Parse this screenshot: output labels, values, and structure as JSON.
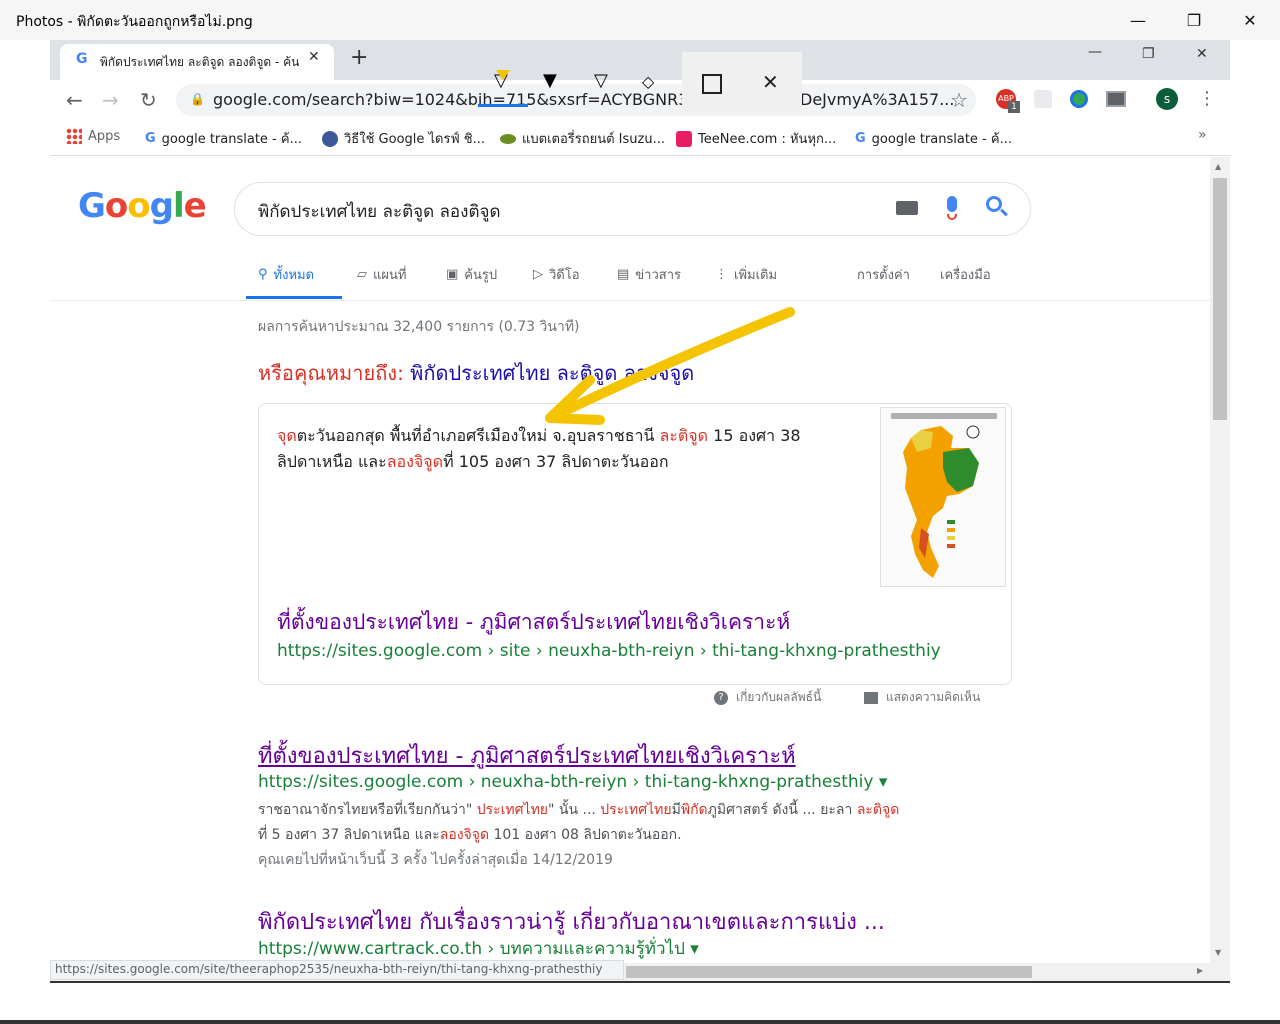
{
  "photos": {
    "title": "Photos - พิกัดตะวันออกถูกหรือไม่.png",
    "minimize": "—",
    "maximize": "❐",
    "close": "✕"
  },
  "browser": {
    "tab_title": "พิกัดประเทศไทย ละติจูด ลองติจูด - ค้นห",
    "tab_close": "✕",
    "new_tab": "+",
    "window_minimize": "—",
    "window_maximize": "❐",
    "window_close": "✕",
    "url": "google.com/search?biw=1024&bih=715&sxsrf=ACYBGNR3_Egj7p",
    "url_tail": "DeJvmyA%3A157...",
    "back": "←",
    "forward": "→",
    "reload": "↻",
    "star": "☆",
    "menu": "⋮",
    "profile_initial": "s",
    "abp_badge": "1"
  },
  "bookmarks": [
    {
      "label": "Apps",
      "icon": "apps-grid-icon"
    },
    {
      "label": "google translate - ค้...",
      "icon": "google-g-icon"
    },
    {
      "label": "วิธีใช้ Google ไดรฟ์ ชิ...",
      "icon": "site-icon"
    },
    {
      "label": "แบตเตอรี่รถยนต์ Isuzu...",
      "icon": "site-icon"
    },
    {
      "label": "TeeNee.com : หันหุก...",
      "icon": "site-icon"
    },
    {
      "label": "google translate - ค้...",
      "icon": "google-g-icon"
    }
  ],
  "bookmarks_more": "»",
  "search": {
    "logo": [
      "G",
      "o",
      "o",
      "g",
      "l",
      "e"
    ],
    "query": "พิกัดประเทศไทย ละติจูด ลองติจูด",
    "tabs": [
      "ทั้งหมด",
      "แผนที่",
      "ค้นรูป",
      "วิดีโอ",
      "ข่าวสาร",
      "เพิ่มเติม"
    ],
    "settings": "การตั้งค่า",
    "tools": "เครื่องมือ",
    "stats": "ผลการค้นหาประมาณ 32,400 รายการ (0.73 วินาที)",
    "did_you_mean_label": "หรือคุณหมายถึง:",
    "did_you_mean_query": "พิกัดประเทศไทย ละติจูด ลองจิจูด"
  },
  "snippet": {
    "line1_a": "จุด",
    "line1_b": "ตะวันออกสุด พื้นที่อำเภอศรีเมืองใหม่ จ.อุบลราชธานี ",
    "line1_c": "ละติจูด",
    "line1_d": " 15 องศา 38",
    "line2_a": "ลิปดาเหนือ และ",
    "line2_b": "ลองจิจูด",
    "line2_c": "ที่ 105 องศา 37 ลิปดาตะวันออก",
    "link": "ที่ตั้งของประเทศไทย - ภูมิศาสตร์ประเทศไทยเชิงวิเคราะห์",
    "cite": "https://sites.google.com › site › neuxha-bth-reiyn › thi-tang-khxng-prathesthiy",
    "about": "เกี่ยวกับผลลัพธ์นี้",
    "feedback": "แสดงความคิดเห็น"
  },
  "results": [
    {
      "title": "ที่ตั้งของประเทศไทย - ภูมิศาสตร์ประเทศไทยเชิงวิเคราะห์",
      "cite": "https://sites.google.com › neuxha-bth-reiyn › thi-tang-khxng-prathesthiy ▾",
      "desc1_a": "ราชอาณาจักรไทยหรือที่เรียกกันว่า\" ",
      "desc1_b": "ประเทศไทย",
      "desc1_c": "\" นั้น ... ",
      "desc1_d": "ประเทศไทย",
      "desc1_e": "มี",
      "desc1_f": "พิกัด",
      "desc1_g": "ภูมิศาสตร์ ดังนี้ ... ยะลา ",
      "desc1_h": "ละติจูด",
      "desc2_a": "ที่ 5 องศา 37 ลิปดาเหนือ และ",
      "desc2_b": "ลองจิจูด",
      "desc2_c": " 101 องศา 08 ลิปดาตะวันออก.",
      "visited": "คุณเคยไปที่หน้าเว็บนี้ 3 ครั้ง ไปครั้งล่าสุดเมื่อ 14/12/2019"
    },
    {
      "title": "พิกัดประเทศไทย กับเรื่องราวน่ารู้ เกี่ยวกับอาณาเขตและการแบ่ง ...",
      "cite": "https://www.cartrack.co.th › บทความและความรู้ทั่วไป ▾"
    }
  ],
  "status_url": "https://sites.google.com/site/theeraphop2535/neuxha-bth-reiyn/thi-tang-khxng-prathesthiy",
  "colors": {
    "link_visited": "#660099",
    "cite_green": "#188038",
    "highlight_red": "#d93025",
    "tab_blue": "#1a73e8",
    "annotation_arrow": "#f5c400"
  }
}
